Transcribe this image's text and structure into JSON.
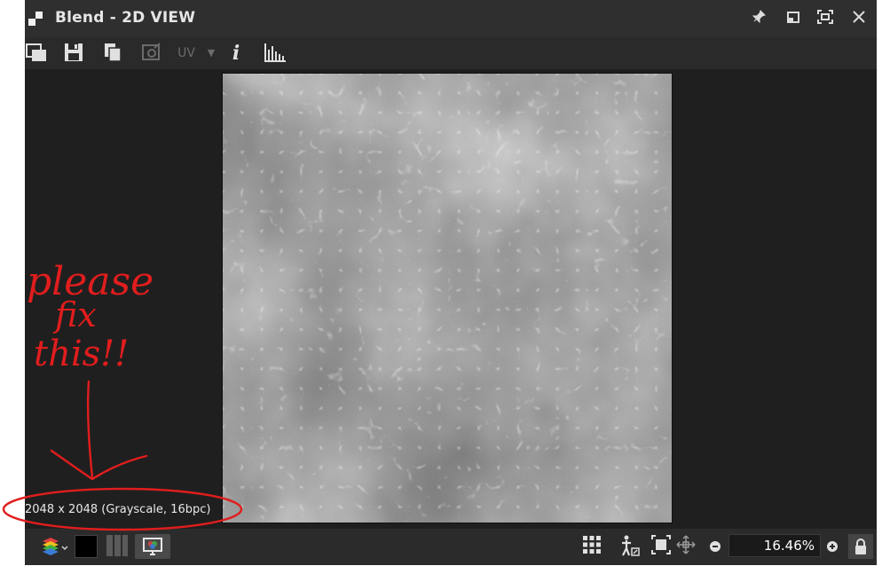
{
  "window": {
    "title": "Blend - 2D VIEW",
    "buttons": {
      "pin": "pin-icon",
      "restore": "restore-icon",
      "maximize": "maximize-icon",
      "close": "close-icon"
    }
  },
  "toolbar": {
    "uv_label": "UV",
    "info_label": "i",
    "icons": [
      "window-layout-icon",
      "save-icon",
      "copy-icon",
      "export-icon",
      "uv-dropdown-icon",
      "info-icon",
      "histogram-icon"
    ]
  },
  "viewport": {
    "image_info": "2048 x 2048 (Grayscale, 16bpc)"
  },
  "bottom": {
    "zoom_value": "16.46%",
    "icons": [
      "layers-icon",
      "black-swatch-icon",
      "channels-icon",
      "display-icon",
      "grid-icon",
      "tiling-icon",
      "fit-icon",
      "pan-icon",
      "zoom-out-icon",
      "zoom-in-icon",
      "lock-icon"
    ]
  },
  "annotation": {
    "line1": "please",
    "line2": "fix",
    "line3": "this!!"
  },
  "colors": {
    "window_bg": "#262626",
    "titlebar_bg": "#2f2f2f",
    "annotation_red": "#e11d1d",
    "accent_blue": "#3a7bd5"
  }
}
